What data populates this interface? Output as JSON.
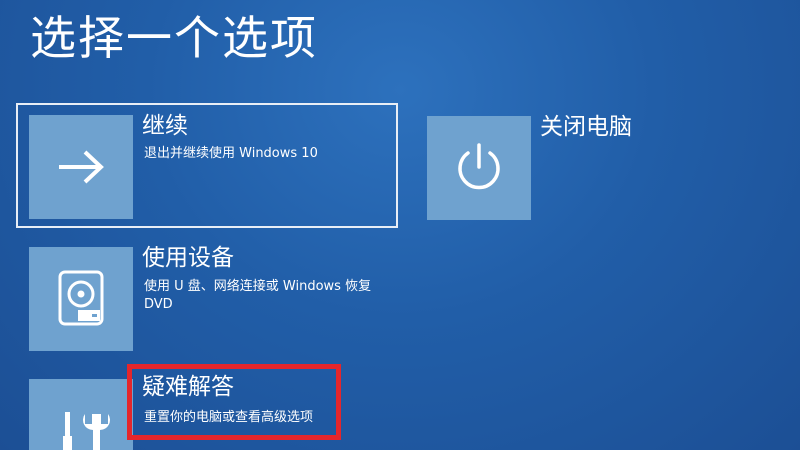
{
  "page": {
    "title": "选择一个选项"
  },
  "options": {
    "continue": {
      "title": "继续",
      "description": "退出并继续使用 Windows 10",
      "icon": "arrow-right-icon",
      "selected": true
    },
    "use_device": {
      "title": "使用设备",
      "description": "使用 U 盘、网络连接或 Windows 恢复 DVD",
      "icon": "disc-drive-icon"
    },
    "troubleshoot": {
      "title": "疑难解答",
      "description": "重置你的电脑或查看高级选项",
      "icon": "tools-icon"
    },
    "shutdown": {
      "title": "关闭电脑",
      "icon": "power-icon"
    }
  },
  "colors": {
    "background": "#215ea8",
    "tile": "#6fa2cf",
    "highlight": "#e4262c"
  }
}
